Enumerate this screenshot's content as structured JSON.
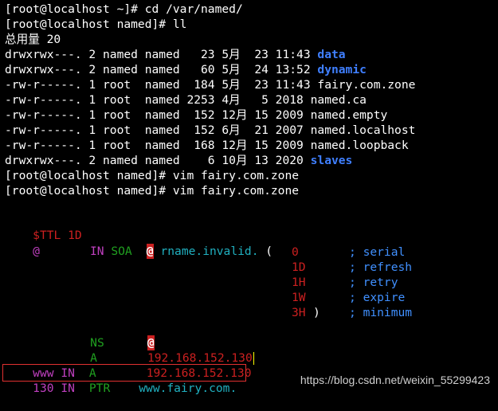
{
  "colors": {
    "background": "#000000",
    "text": "#ffffff",
    "directory": "#3f7fff",
    "red": "#cc2020",
    "magenta": "#c040c0",
    "green": "#20a020",
    "cyan": "#20b0c0",
    "blue": "#4090ff",
    "box": "#e03030"
  },
  "shell": {
    "line1": "[root@localhost ~]# cd /var/named/",
    "line2": "[root@localhost named]# ll",
    "total": "总用量 20",
    "listing": [
      {
        "prefix": "drwxrwx---. 2 named named   23 5月  23 11:43 ",
        "name": "data",
        "type": "dir"
      },
      {
        "prefix": "drwxrwx---. 2 named named   60 5月  24 13:52 ",
        "name": "dynamic",
        "type": "dir"
      },
      {
        "prefix": "-rw-r-----. 1 root  named  184 5月  23 11:43 ",
        "name": "fairy.com.zone",
        "type": "file"
      },
      {
        "prefix": "-rw-r-----. 1 root  named 2253 4月   5 2018 ",
        "name": "named.ca",
        "type": "file"
      },
      {
        "prefix": "-rw-r-----. 1 root  named  152 12月 15 2009 ",
        "name": "named.empty",
        "type": "file"
      },
      {
        "prefix": "-rw-r-----. 1 root  named  152 6月  21 2007 ",
        "name": "named.localhost",
        "type": "file"
      },
      {
        "prefix": "-rw-r-----. 1 root  named  168 12月 15 2009 ",
        "name": "named.loopback",
        "type": "file"
      },
      {
        "prefix": "drwxrwx---. 2 named named    6 10月 13 2020 ",
        "name": "slaves",
        "type": "dir"
      }
    ],
    "vim1": "[root@localhost named]# vim fairy.com.zone",
    "vim2": "[root@localhost named]# vim fairy.com.zone"
  },
  "zone": {
    "ttl_keyword": "$TTL",
    "ttl_value": "1D",
    "soa_at": "@",
    "soa_in": "IN",
    "soa_type": "SOA",
    "soa_at2": "@",
    "soa_rname": "rname.invalid.",
    "soa_paren": "(",
    "soa_params": [
      {
        "value": "0",
        "comment": "; serial"
      },
      {
        "value": "1D",
        "comment": "; refresh"
      },
      {
        "value": "1H",
        "comment": "; retry"
      },
      {
        "value": "1W",
        "comment": "; expire"
      },
      {
        "value": "3H",
        "close": ")",
        "comment": "; minimum"
      }
    ],
    "ns_type": "NS",
    "ns_value": "@",
    "a_type": "A",
    "a_value": "192.168.152.130",
    "www_name": "www",
    "www_in": "IN",
    "www_type": "A",
    "www_value": "192.168.152.130",
    "ptr_name": "130",
    "ptr_in": "IN",
    "ptr_type": "PTR",
    "ptr_value": "www.fairy.com."
  },
  "watermark": "https://blog.csdn.net/weixin_55299423"
}
